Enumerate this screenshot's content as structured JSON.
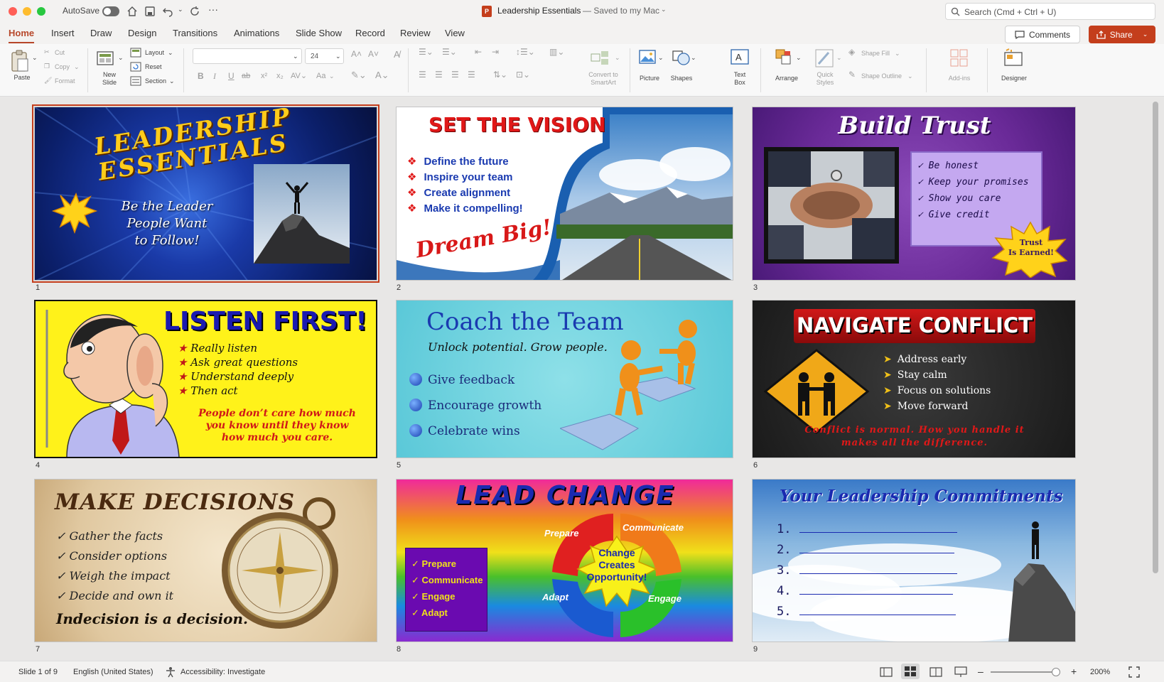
{
  "titlebar": {
    "autosave": "AutoSave",
    "doc_title": "Leadership Essentials",
    "save_status": "— Saved to my Mac",
    "search_placeholder": "Search (Cmd + Ctrl + U)"
  },
  "tabs": [
    "Home",
    "Insert",
    "Draw",
    "Design",
    "Transitions",
    "Animations",
    "Slide Show",
    "Record",
    "Review",
    "View"
  ],
  "actions": {
    "comments": "Comments",
    "share": "Share"
  },
  "ribbon": {
    "paste": "Paste",
    "cut": "Cut",
    "copy": "Copy",
    "format": "Format",
    "new_slide": [
      "New",
      "Slide"
    ],
    "layout": "Layout",
    "reset": "Reset",
    "section": "Section",
    "font_name": "",
    "font_size": "24",
    "convert_smartart": [
      "Convert to",
      "SmartArt"
    ],
    "picture": "Picture",
    "shapes": "Shapes",
    "text_box": [
      "Text",
      "Box"
    ],
    "arrange": "Arrange",
    "quick_styles": [
      "Quick",
      "Styles"
    ],
    "shape_fill": "Shape Fill",
    "shape_outline": "Shape Outline",
    "addins": "Add-ins",
    "designer": "Designer",
    "bold": "B",
    "italic": "I",
    "underline": "U",
    "strike": "ab",
    "super": "x²",
    "sub": "x₂",
    "aa": "Aa"
  },
  "slides": [
    {
      "num": "1",
      "title": [
        "LEADERSHIP",
        "ESSENTIALS"
      ],
      "subtitle": [
        "Be the Leader",
        "People Want",
        "to Follow!"
      ]
    },
    {
      "num": "2",
      "title": "SET THE VISION",
      "bullets": [
        "Define the future",
        "Inspire your team",
        "Create alignment",
        "Make it compelling!"
      ],
      "tagline": "Dream Big!"
    },
    {
      "num": "3",
      "title": "Build Trust",
      "bullets": [
        "Be honest",
        "Keep your promises",
        "Show you care",
        "Give credit"
      ],
      "burst": [
        "Trust",
        "Is Earned!"
      ]
    },
    {
      "num": "4",
      "title": "LISTEN FIRST!",
      "bullets": [
        "Really listen",
        "Ask great questions",
        "Understand deeply",
        "Then act"
      ],
      "quote": [
        "People don’t care how much",
        "you know until they know",
        "how much you care."
      ]
    },
    {
      "num": "5",
      "title": "Coach the Team",
      "subtitle": "Unlock potential. Grow people.",
      "bullets": [
        "Give feedback",
        "Encourage growth",
        "Celebrate wins"
      ]
    },
    {
      "num": "6",
      "title": "NAVIGATE CONFLICT",
      "bullets": [
        "Address early",
        "Stay calm",
        "Focus on solutions",
        "Move forward"
      ],
      "footer": [
        "Conflict is normal. How you handle it",
        "makes all the difference."
      ]
    },
    {
      "num": "7",
      "title": "MAKE DECISIONS",
      "bullets": [
        "Gather the facts",
        "Consider options",
        "Weigh the impact",
        "Decide and own it"
      ],
      "footer": "Indecision is a decision."
    },
    {
      "num": "8",
      "title": "LEAD CHANGE",
      "box": [
        "Prepare",
        "Communicate",
        "Engage",
        "Adapt"
      ],
      "cycle": [
        "Prepare",
        "Communicate",
        "Engage",
        "Adapt"
      ],
      "center": [
        "Change",
        "Creates",
        "Opportunity!"
      ]
    },
    {
      "num": "9",
      "title": "Your Leadership Commitments",
      "lines": [
        "1.",
        "2.",
        "3.",
        "4.",
        "5."
      ]
    }
  ],
  "status": {
    "slide_of": "Slide 1 of 9",
    "language": "English (United States)",
    "accessibility": "Accessibility: Investigate",
    "zoom": "200%"
  },
  "colors": {
    "accent": "#b7472a",
    "share": "#c43e1c"
  }
}
